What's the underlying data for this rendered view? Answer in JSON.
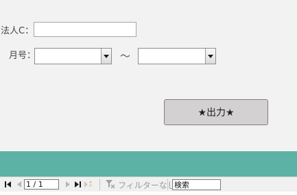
{
  "form": {
    "corp_label": "法人C：",
    "corp_value": "",
    "month_label": "月号：",
    "month_from_value": "",
    "month_to_value": "",
    "range_separator": "～",
    "output_button": "★出力★"
  },
  "navigation": {
    "record_position": "1 / 1",
    "filter_label": "フィルターなし",
    "search_placeholder": "検索"
  },
  "colors": {
    "form_background": "#f2f2f2",
    "footer_band": "#5bb2a5",
    "button_face": "#d3d1d2"
  },
  "icons": {
    "first": "first-record-icon",
    "prev": "previous-record-icon",
    "next": "next-record-icon",
    "last": "last-record-icon",
    "new": "new-record-icon",
    "filter": "filter-icon",
    "dropdown": "chevron-down-icon"
  }
}
